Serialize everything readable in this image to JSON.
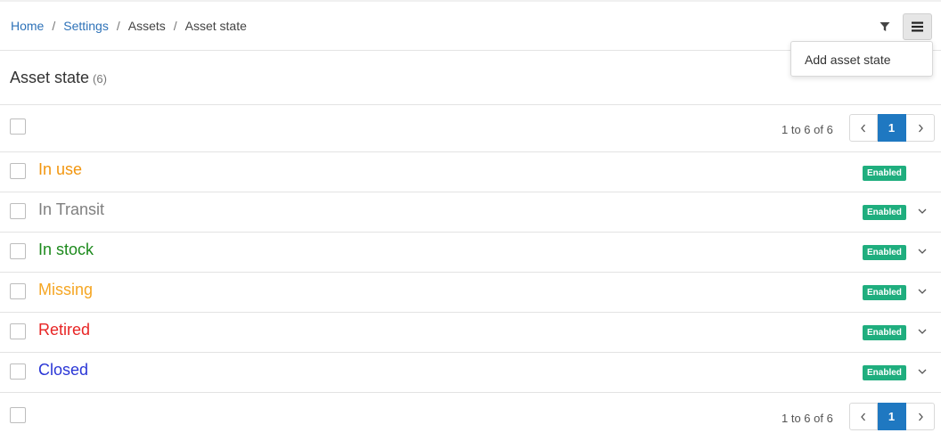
{
  "breadcrumb": [
    {
      "label": "Home",
      "link": true
    },
    {
      "label": "Settings",
      "link": true
    },
    {
      "label": "Assets",
      "link": false
    },
    {
      "label": "Asset state",
      "link": false
    }
  ],
  "breadcrumb_separator": "/",
  "toolbar": {
    "filter_icon": "filter-icon",
    "menu_icon": "hamburger-menu-icon"
  },
  "dropdown": {
    "items": [
      "Add asset state"
    ]
  },
  "header": {
    "title": "Asset state",
    "count": "(6)"
  },
  "pagination": {
    "info": "1 to 6 of 6",
    "current_page": "1",
    "prev_icon": "chevron-left-icon",
    "next_icon": "chevron-right-icon"
  },
  "rows": [
    {
      "name": "In use",
      "color": "#f2960f",
      "status": "Enabled",
      "expandable": false
    },
    {
      "name": "In Transit",
      "color": "#808080",
      "status": "Enabled",
      "expandable": true
    },
    {
      "name": "In stock",
      "color": "#1d8a1d",
      "status": "Enabled",
      "expandable": true
    },
    {
      "name": "Missing",
      "color": "#f5a623",
      "status": "Enabled",
      "expandable": true
    },
    {
      "name": "Retired",
      "color": "#e82525",
      "status": "Enabled",
      "expandable": true
    },
    {
      "name": "Closed",
      "color": "#2a36d6",
      "status": "Enabled",
      "expandable": true
    }
  ],
  "colors": {
    "link": "#2e72b8",
    "badge": "#1fae7e",
    "pager_active": "#1f78c1"
  }
}
